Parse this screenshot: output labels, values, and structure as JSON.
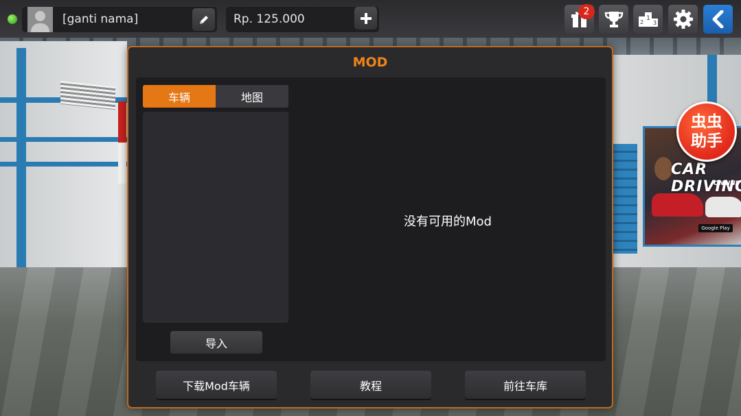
{
  "topbar": {
    "player_name": "[ganti nama]",
    "money": "Rp. 125.000",
    "gift_badge": "2",
    "icons": [
      "online-status",
      "avatar",
      "pencil-icon",
      "plus-icon",
      "gift-icon",
      "trophy-icon",
      "leaderboard-icon",
      "gear-icon",
      "back-arrow-icon"
    ]
  },
  "panel": {
    "title": "MOD",
    "tabs": [
      {
        "label": "车辆",
        "active": true
      },
      {
        "label": "地图",
        "active": false
      }
    ],
    "import_label": "导入",
    "empty_message": "没有可用的Mod",
    "buttons": {
      "download": "下载Mod车辆",
      "tutorial": "教程",
      "garage": "前往车库"
    }
  },
  "overlay": {
    "helper_line1": "虫虫",
    "helper_line2": "助手"
  },
  "poster": {
    "title": "CAR DRIVING",
    "subtitle": "ONLINE",
    "store": "Google Play"
  },
  "colors": {
    "accent": "#e57714",
    "panel_border": "#c36a1a",
    "badge": "#d8261c",
    "back_button": "#1a5fae"
  }
}
